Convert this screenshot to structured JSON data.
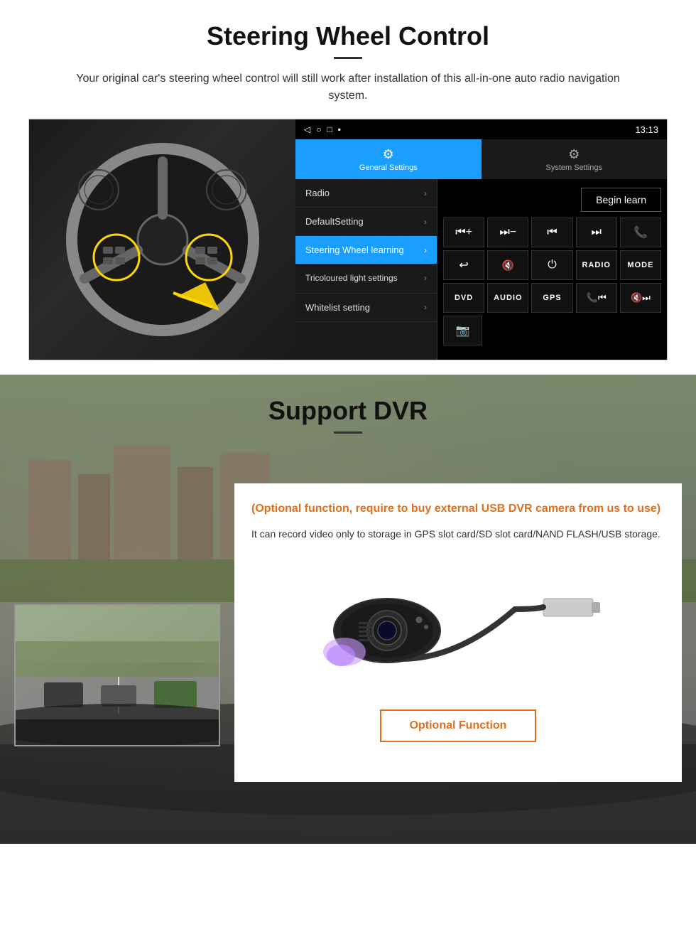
{
  "steering_section": {
    "title": "Steering Wheel Control",
    "subtitle": "Your original car's steering wheel control will still work after installation of this all-in-one auto radio navigation system.",
    "android_ui": {
      "status_bar": {
        "time": "13:13",
        "icons": "▷ ○ □ ▪"
      },
      "tabs": [
        {
          "label": "General Settings",
          "active": true,
          "icon": "⚙"
        },
        {
          "label": "System Settings",
          "active": false,
          "icon": "🔧"
        }
      ],
      "menu_items": [
        {
          "label": "Radio",
          "active": false
        },
        {
          "label": "DefaultSetting",
          "active": false
        },
        {
          "label": "Steering Wheel learning",
          "active": true
        },
        {
          "label": "Tricoloured light settings",
          "active": false
        },
        {
          "label": "Whitelist setting",
          "active": false
        }
      ],
      "begin_learn_label": "Begin learn",
      "control_buttons_row1": [
        "⏮+",
        "⏭−",
        "⏮⏮",
        "⏭⏭",
        "📞"
      ],
      "control_buttons_row2": [
        "↩",
        "🔇",
        "⏻",
        "RADIO",
        "MODE"
      ],
      "control_buttons_row3": [
        "DVD",
        "AUDIO",
        "GPS",
        "📞⏮",
        "🔇⏭"
      ],
      "control_buttons_row4": [
        "📷"
      ]
    }
  },
  "dvr_section": {
    "title": "Support DVR",
    "optional_text": "(Optional function, require to buy external USB DVR camera from us to use)",
    "description": "It can record video only to storage in GPS slot card/SD slot card/NAND FLASH/USB storage.",
    "optional_function_label": "Optional Function"
  }
}
